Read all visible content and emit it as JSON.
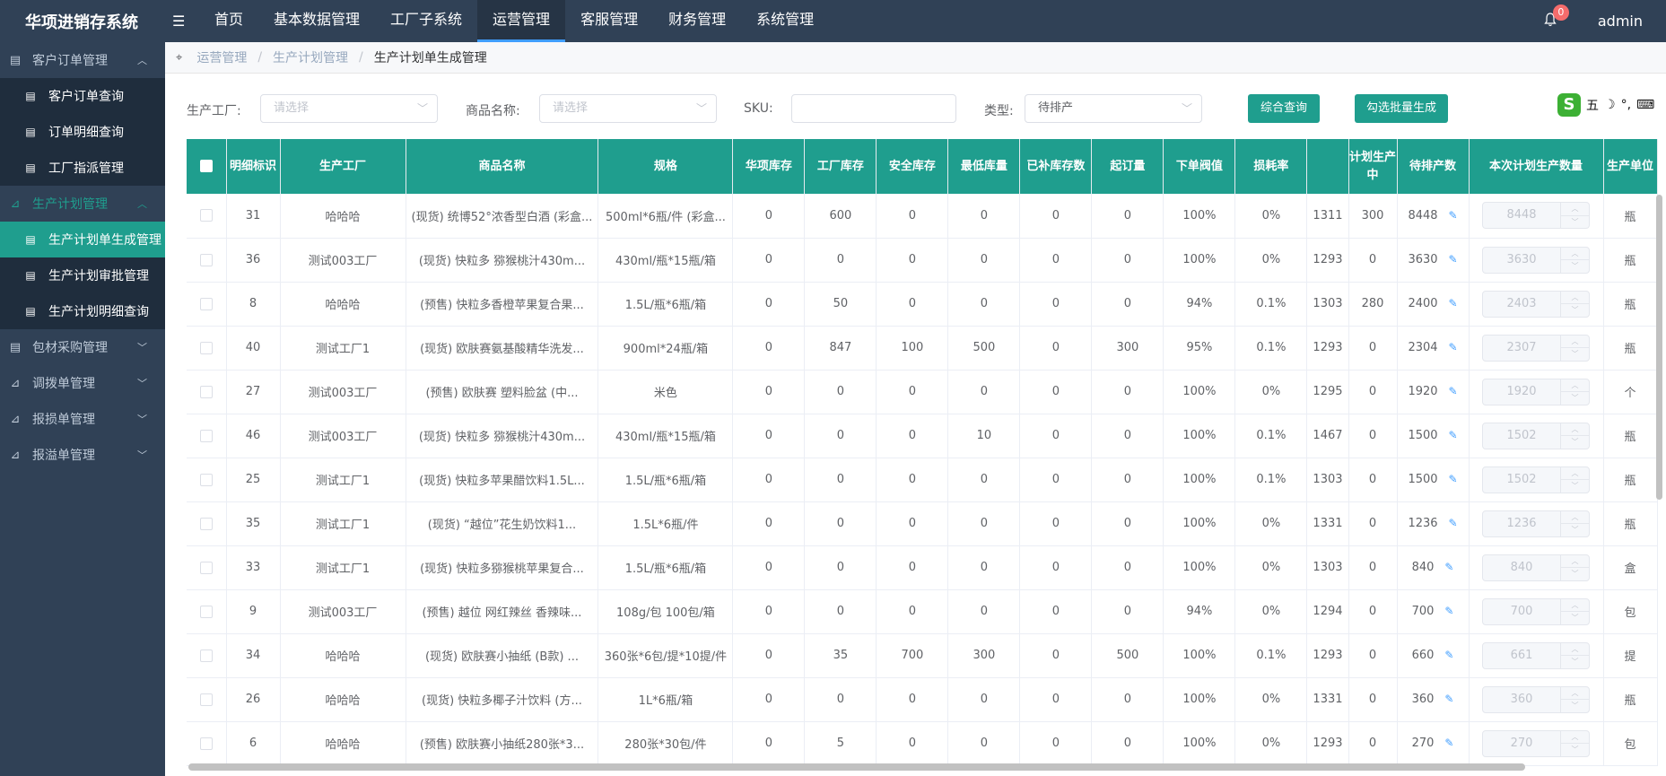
{
  "app": {
    "title": "华项进销存系统",
    "collapse_icon": "☰"
  },
  "topnav": [
    "首页",
    "基本数据管理",
    "工厂子系统",
    "运营管理",
    "客服管理",
    "财务管理",
    "系统管理"
  ],
  "notifications": {
    "count": "0"
  },
  "user": {
    "name": "admin"
  },
  "sidebar": {
    "g1": "客户订单管理",
    "g1_items": [
      "客户订单查询",
      "订单明细查询",
      "工厂指派管理"
    ],
    "g2": "生产计划管理",
    "g2_items": [
      "生产计划单生成管理",
      "生产计划审批管理",
      "生产计划明细查询"
    ],
    "g3": "包材采购管理",
    "g4": "调拨单管理",
    "g5": "报损单管理",
    "g6": "报溢单管理"
  },
  "breadcrumb": {
    "l1": "运营管理",
    "l2": "生产计划管理",
    "current": "生产计划单生成管理",
    "sep": "/"
  },
  "filters": {
    "factory_label": "生产工厂:",
    "factory_placeholder": "请选择",
    "product_label": "商品名称:",
    "product_placeholder": "请选择",
    "sku_label": "SKU:",
    "sku_value": "",
    "type_label": "类型:",
    "type_value": "待排产",
    "query_button": "综合查询",
    "batch_button": "勾选批量生成"
  },
  "ime": {
    "s": "S",
    "wu": "五",
    "moon": "☽",
    "dot": "°,",
    "kbd": "⌨"
  },
  "table": {
    "headers": [
      "明细标识",
      "生产工厂",
      "商品名称",
      "规格",
      "华项库存",
      "工厂库存",
      "安全库存",
      "最低库量",
      "已补库存数",
      "起订量",
      "下单阀值",
      "损耗率",
      "",
      "计划生产中",
      "待排产数",
      "本次计划生产数量",
      "生产单位"
    ],
    "rows": [
      [
        "31",
        "哈哈哈",
        "(现货) 统博52°浓香型白酒 (彩盒...",
        "500ml*6瓶/件 (彩盒...",
        "0",
        "600",
        "0",
        "0",
        "0",
        "0",
        "100%",
        "0%",
        "1311",
        "300",
        "8448",
        "8448",
        "瓶"
      ],
      [
        "36",
        "测试003工厂",
        "(现货) 快粒多 猕猴桃汁430m...",
        "430ml/瓶*15瓶/箱",
        "0",
        "0",
        "0",
        "0",
        "0",
        "0",
        "100%",
        "0%",
        "1293",
        "0",
        "3630",
        "3630",
        "瓶"
      ],
      [
        "8",
        "哈哈哈",
        "(预售) 快粒多香橙苹果复合果...",
        "1.5L/瓶*6瓶/箱",
        "0",
        "50",
        "0",
        "0",
        "0",
        "0",
        "94%",
        "0.1%",
        "1303",
        "280",
        "2400",
        "2403",
        "瓶"
      ],
      [
        "40",
        "测试工厂1",
        "(现货) 欧肤赛氨基酸精华洗发...",
        "900ml*24瓶/箱",
        "0",
        "847",
        "100",
        "500",
        "0",
        "300",
        "95%",
        "0.1%",
        "1293",
        "0",
        "2304",
        "2307",
        "瓶"
      ],
      [
        "27",
        "测试003工厂",
        "(预售) 欧肤赛 塑料脸盆 (中...",
        "米色",
        "0",
        "0",
        "0",
        "0",
        "0",
        "0",
        "100%",
        "0%",
        "1295",
        "0",
        "1920",
        "1920",
        "个"
      ],
      [
        "46",
        "测试003工厂",
        "(现货) 快粒多 猕猴桃汁430m...",
        "430ml/瓶*15瓶/箱",
        "0",
        "0",
        "0",
        "10",
        "0",
        "0",
        "100%",
        "0.1%",
        "1467",
        "0",
        "1500",
        "1502",
        "瓶"
      ],
      [
        "25",
        "测试工厂1",
        "(现货) 快粒多苹果醋饮料1.5L...",
        "1.5L/瓶*6瓶/箱",
        "0",
        "0",
        "0",
        "0",
        "0",
        "0",
        "100%",
        "0.1%",
        "1303",
        "0",
        "1500",
        "1502",
        "瓶"
      ],
      [
        "35",
        "测试工厂1",
        "(现货) “越位”花生奶饮料1...",
        "1.5L*6瓶/件",
        "0",
        "0",
        "0",
        "0",
        "0",
        "0",
        "100%",
        "0%",
        "1331",
        "0",
        "1236",
        "1236",
        "瓶"
      ],
      [
        "33",
        "测试工厂1",
        "(现货) 快粒多猕猴桃苹果复合...",
        "1.5L/瓶*6瓶/箱",
        "0",
        "0",
        "0",
        "0",
        "0",
        "0",
        "100%",
        "0%",
        "1303",
        "0",
        "840",
        "840",
        "盒"
      ],
      [
        "9",
        "测试003工厂",
        "(预售) 越位 网红辣丝 香辣味...",
        "108g/包 100包/箱",
        "0",
        "0",
        "0",
        "0",
        "0",
        "0",
        "94%",
        "0%",
        "1294",
        "0",
        "700",
        "700",
        "包"
      ],
      [
        "34",
        "哈哈哈",
        "(现货) 欧肤赛小抽纸 (B款) ...",
        "360张*6包/提*10提/件",
        "0",
        "35",
        "700",
        "300",
        "0",
        "500",
        "100%",
        "0.1%",
        "1293",
        "0",
        "660",
        "661",
        "提"
      ],
      [
        "26",
        "哈哈哈",
        "(现货) 快粒多椰子汁饮料 (方...",
        "1L*6瓶/箱",
        "0",
        "0",
        "0",
        "0",
        "0",
        "0",
        "100%",
        "0%",
        "1331",
        "0",
        "360",
        "360",
        "瓶"
      ],
      [
        "6",
        "哈哈哈",
        "(预售) 欧肤赛小抽纸280张*3...",
        "280张*30包/件",
        "0",
        "5",
        "0",
        "0",
        "0",
        "0",
        "100%",
        "0%",
        "1293",
        "0",
        "270",
        "270",
        "包"
      ]
    ]
  },
  "icons": {
    "edit": "✎",
    "up": "︿",
    "down": "﹀",
    "pin": "⌖",
    "bell": "🔔"
  }
}
